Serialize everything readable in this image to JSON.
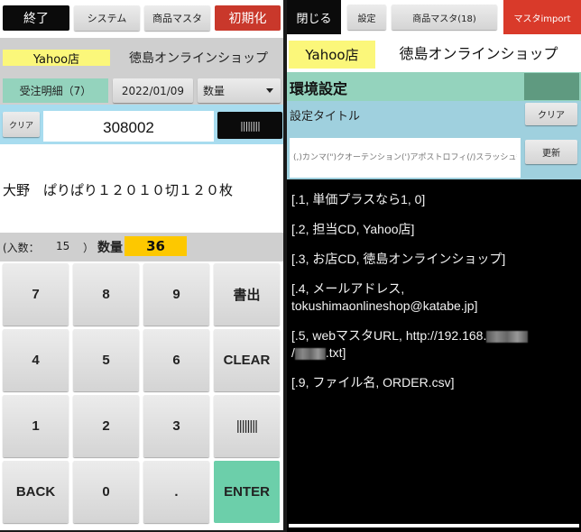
{
  "left_screen": {
    "toolbar": {
      "exit_label": "終了",
      "system_label": "システム",
      "product_master_label": "商品マスタ",
      "initialize_label": "初期化"
    },
    "store_name": "Yahoo店",
    "shop_name": "徳島オンラインショップ",
    "orders_label": "受注明細（7）",
    "date": "2022/01/09",
    "mode_select": {
      "selected": "数量"
    },
    "clear_label": "クリア",
    "code_value": "308002",
    "scan_button_label": "||||||||",
    "product_name": "大野　ぱりぱり１２０１０切１２０枚",
    "pack": {
      "label": "(入数：",
      "value": "15",
      "close": "）"
    },
    "quantity": {
      "label": "数量",
      "value": "36"
    },
    "keypad": [
      [
        "7",
        "8",
        "9",
        "書出"
      ],
      [
        "4",
        "5",
        "6",
        "CLEAR"
      ],
      [
        "1",
        "2",
        "3",
        "||||||||"
      ],
      [
        "BACK",
        "0",
        ".",
        "ENTER"
      ]
    ],
    "colors": {
      "exit": "#0b0b0b",
      "initialize": "#c9382b",
      "store_highlight": "#fbf77a",
      "orders": "#94d3bd",
      "scan_row": "#a8dcef",
      "quantity_highlight": "#fdc800",
      "enter": "#6ccfaa"
    }
  },
  "right_screen": {
    "toolbar": {
      "close_label": "閉じる",
      "settings_label": "設定",
      "product_master_label": "商品マスタ(18)",
      "master_import_label": "マスタimport"
    },
    "store_name": "Yahoo店",
    "shop_name": "徳島オンラインショップ",
    "section_title": "環境設定",
    "setting_title_label": "設定タイトル",
    "clear_label": "クリア",
    "input_placeholder": "(,)カンマ(\")クオーテンション(')アポストロフィ(/)スラッシュ等は",
    "update_label": "更新",
    "settings": [
      {
        "text": "[.1, 単価プラスなら1, 0]"
      },
      {
        "text": "[.2, 担当CD, Yahoo店]"
      },
      {
        "text": "[.3, お店CD, 徳島オンラインショップ]"
      },
      {
        "text": "[.4, メールアドレス,\ntokushimaonlineshop@katabe.jp]"
      },
      {
        "prefix": "[.5, webマスタURL, http://192.168.",
        "middle": "/",
        "suffix": ".txt]",
        "redacted": true
      },
      {
        "text": "[.9, ファイル名, ORDER.csv]"
      }
    ],
    "colors": {
      "close": "#0b0b0b",
      "import": "#d93a2a",
      "section": "#94d3bd",
      "section_box": "#5f9a80",
      "settings_row": "#9fd0de"
    }
  }
}
